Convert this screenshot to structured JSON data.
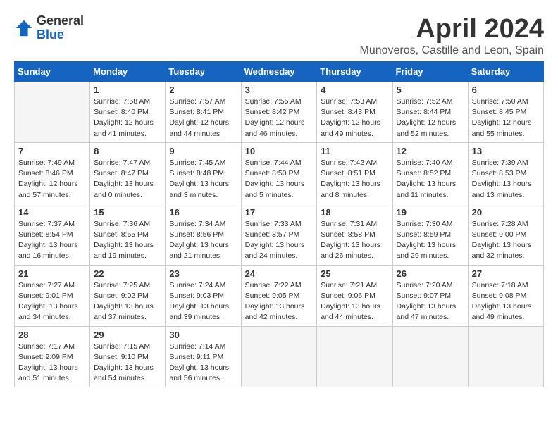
{
  "header": {
    "logo": {
      "general": "General",
      "blue": "Blue"
    },
    "title": "April 2024",
    "subtitle": "Munoveros, Castille and Leon, Spain"
  },
  "columns": [
    "Sunday",
    "Monday",
    "Tuesday",
    "Wednesday",
    "Thursday",
    "Friday",
    "Saturday"
  ],
  "weeks": [
    [
      {
        "num": "",
        "empty": true
      },
      {
        "num": "1",
        "sunrise": "7:58 AM",
        "sunset": "8:40 PM",
        "daylight": "12 hours and 41 minutes."
      },
      {
        "num": "2",
        "sunrise": "7:57 AM",
        "sunset": "8:41 PM",
        "daylight": "12 hours and 44 minutes."
      },
      {
        "num": "3",
        "sunrise": "7:55 AM",
        "sunset": "8:42 PM",
        "daylight": "12 hours and 46 minutes."
      },
      {
        "num": "4",
        "sunrise": "7:53 AM",
        "sunset": "8:43 PM",
        "daylight": "12 hours and 49 minutes."
      },
      {
        "num": "5",
        "sunrise": "7:52 AM",
        "sunset": "8:44 PM",
        "daylight": "12 hours and 52 minutes."
      },
      {
        "num": "6",
        "sunrise": "7:50 AM",
        "sunset": "8:45 PM",
        "daylight": "12 hours and 55 minutes."
      }
    ],
    [
      {
        "num": "7",
        "sunrise": "7:49 AM",
        "sunset": "8:46 PM",
        "daylight": "12 hours and 57 minutes."
      },
      {
        "num": "8",
        "sunrise": "7:47 AM",
        "sunset": "8:47 PM",
        "daylight": "13 hours and 0 minutes."
      },
      {
        "num": "9",
        "sunrise": "7:45 AM",
        "sunset": "8:48 PM",
        "daylight": "13 hours and 3 minutes."
      },
      {
        "num": "10",
        "sunrise": "7:44 AM",
        "sunset": "8:50 PM",
        "daylight": "13 hours and 5 minutes."
      },
      {
        "num": "11",
        "sunrise": "7:42 AM",
        "sunset": "8:51 PM",
        "daylight": "13 hours and 8 minutes."
      },
      {
        "num": "12",
        "sunrise": "7:40 AM",
        "sunset": "8:52 PM",
        "daylight": "13 hours and 11 minutes."
      },
      {
        "num": "13",
        "sunrise": "7:39 AM",
        "sunset": "8:53 PM",
        "daylight": "13 hours and 13 minutes."
      }
    ],
    [
      {
        "num": "14",
        "sunrise": "7:37 AM",
        "sunset": "8:54 PM",
        "daylight": "13 hours and 16 minutes."
      },
      {
        "num": "15",
        "sunrise": "7:36 AM",
        "sunset": "8:55 PM",
        "daylight": "13 hours and 19 minutes."
      },
      {
        "num": "16",
        "sunrise": "7:34 AM",
        "sunset": "8:56 PM",
        "daylight": "13 hours and 21 minutes."
      },
      {
        "num": "17",
        "sunrise": "7:33 AM",
        "sunset": "8:57 PM",
        "daylight": "13 hours and 24 minutes."
      },
      {
        "num": "18",
        "sunrise": "7:31 AM",
        "sunset": "8:58 PM",
        "daylight": "13 hours and 26 minutes."
      },
      {
        "num": "19",
        "sunrise": "7:30 AM",
        "sunset": "8:59 PM",
        "daylight": "13 hours and 29 minutes."
      },
      {
        "num": "20",
        "sunrise": "7:28 AM",
        "sunset": "9:00 PM",
        "daylight": "13 hours and 32 minutes."
      }
    ],
    [
      {
        "num": "21",
        "sunrise": "7:27 AM",
        "sunset": "9:01 PM",
        "daylight": "13 hours and 34 minutes."
      },
      {
        "num": "22",
        "sunrise": "7:25 AM",
        "sunset": "9:02 PM",
        "daylight": "13 hours and 37 minutes."
      },
      {
        "num": "23",
        "sunrise": "7:24 AM",
        "sunset": "9:03 PM",
        "daylight": "13 hours and 39 minutes."
      },
      {
        "num": "24",
        "sunrise": "7:22 AM",
        "sunset": "9:05 PM",
        "daylight": "13 hours and 42 minutes."
      },
      {
        "num": "25",
        "sunrise": "7:21 AM",
        "sunset": "9:06 PM",
        "daylight": "13 hours and 44 minutes."
      },
      {
        "num": "26",
        "sunrise": "7:20 AM",
        "sunset": "9:07 PM",
        "daylight": "13 hours and 47 minutes."
      },
      {
        "num": "27",
        "sunrise": "7:18 AM",
        "sunset": "9:08 PM",
        "daylight": "13 hours and 49 minutes."
      }
    ],
    [
      {
        "num": "28",
        "sunrise": "7:17 AM",
        "sunset": "9:09 PM",
        "daylight": "13 hours and 51 minutes."
      },
      {
        "num": "29",
        "sunrise": "7:15 AM",
        "sunset": "9:10 PM",
        "daylight": "13 hours and 54 minutes."
      },
      {
        "num": "30",
        "sunrise": "7:14 AM",
        "sunset": "9:11 PM",
        "daylight": "13 hours and 56 minutes."
      },
      {
        "num": "",
        "empty": true
      },
      {
        "num": "",
        "empty": true
      },
      {
        "num": "",
        "empty": true
      },
      {
        "num": "",
        "empty": true
      }
    ]
  ],
  "labels": {
    "sunrise": "Sunrise:",
    "sunset": "Sunset:",
    "daylight": "Daylight:"
  }
}
